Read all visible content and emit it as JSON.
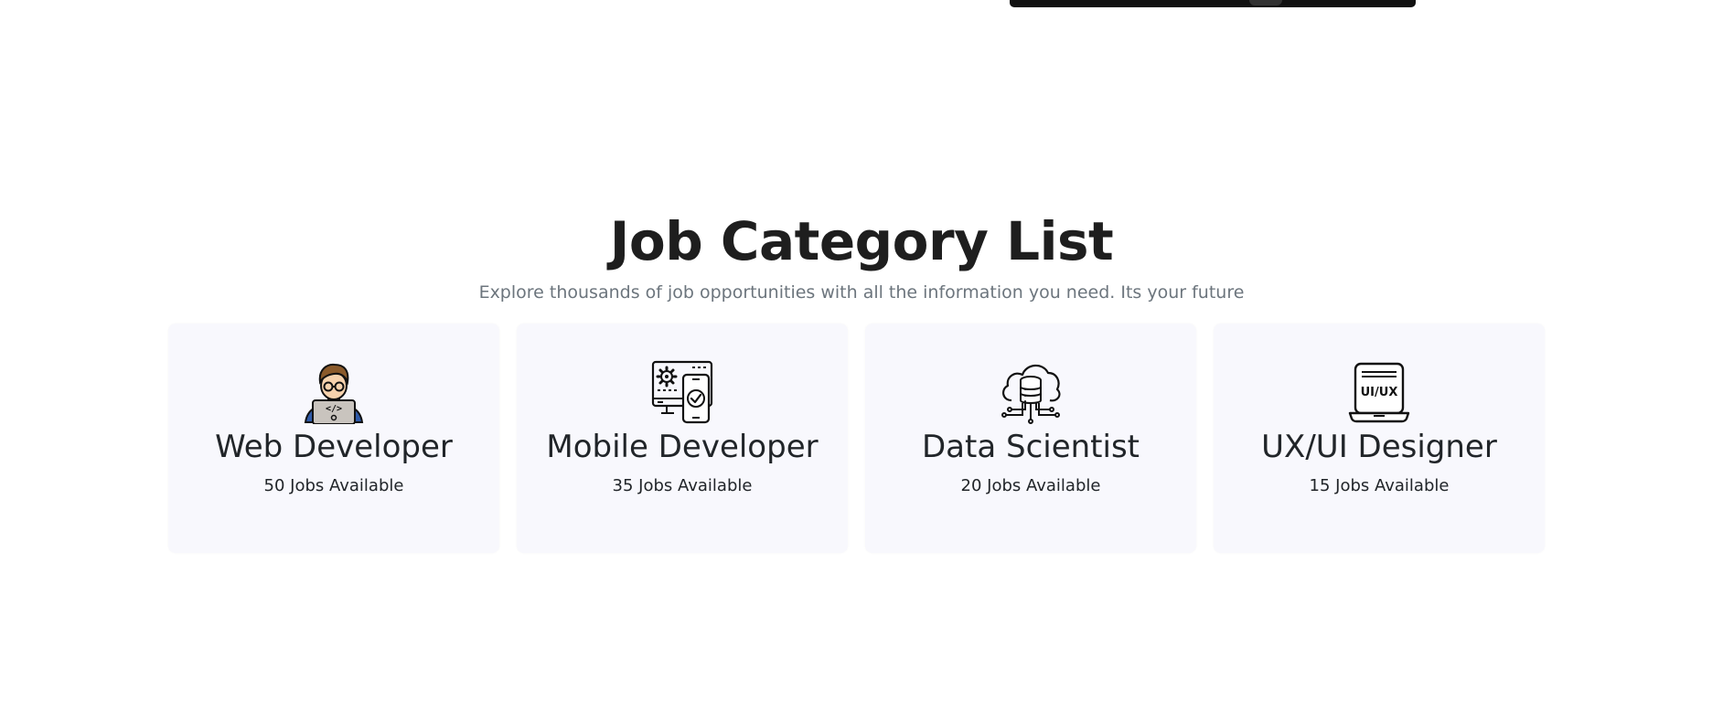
{
  "section": {
    "title": "Job Category List",
    "subtitle": "Explore thousands of job opportunities with all the information you need. Its your future"
  },
  "categories": [
    {
      "title": "Web Developer",
      "count": "50 Jobs Available",
      "icon": "web-developer-icon"
    },
    {
      "title": "Mobile Developer",
      "count": "35 Jobs Available",
      "icon": "mobile-developer-icon"
    },
    {
      "title": "Data Scientist",
      "count": "20 Jobs Available",
      "icon": "cloud-database-icon"
    },
    {
      "title": "UX/UI Designer",
      "count": "15 Jobs Available",
      "icon": "ux-ui-laptop-icon",
      "icon_text": "UI/UX"
    }
  ],
  "colors": {
    "card_background": "#f8f8fd",
    "title_color": "#1e1e1e",
    "subtitle_color": "#6c757d"
  }
}
